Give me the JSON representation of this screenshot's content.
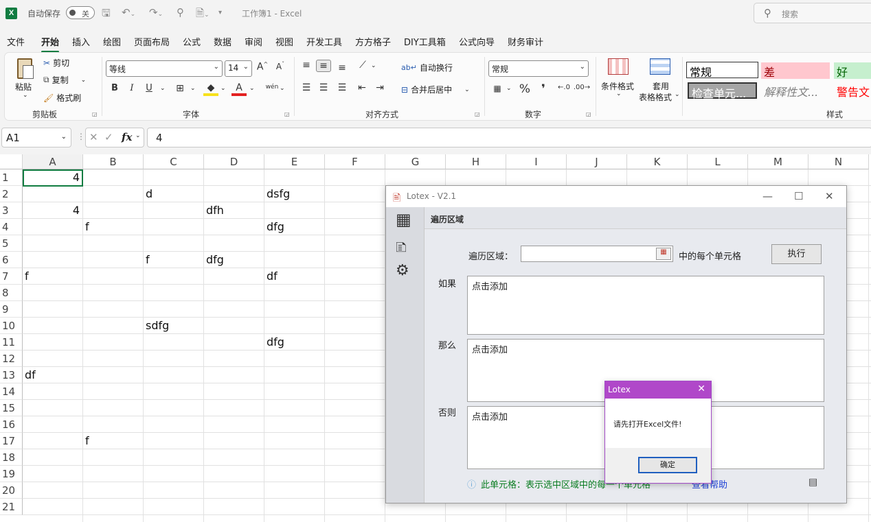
{
  "titlebar": {
    "logo": "X",
    "autosave_label": "自动保存",
    "autosave_state": "关",
    "doc_title": "工作簿1  -  Excel",
    "search_placeholder": "搜索",
    "icons": [
      "save-icon",
      "undo-icon",
      "redo-icon",
      "search-icon",
      "form-icon",
      "more-icon"
    ]
  },
  "menu": [
    "文件",
    "开始",
    "插入",
    "绘图",
    "页面布局",
    "公式",
    "数据",
    "审阅",
    "视图",
    "开发工具",
    "方方格子",
    "DIY工具箱",
    "公式向导",
    "财务审计"
  ],
  "active_menu": "开始",
  "ribbon": {
    "clipboard": {
      "paste": "粘贴",
      "cut": "剪切",
      "copy": "复制",
      "format_painter": "格式刷",
      "group": "剪贴板"
    },
    "font": {
      "family": "等线",
      "size": "14",
      "bold": "B",
      "italic": "I",
      "underline": "U",
      "phonetic": "wén",
      "group": "字体"
    },
    "alignment": {
      "wrap": "自动换行",
      "merge": "合并后居中",
      "group": "对齐方式"
    },
    "number": {
      "format": "常规",
      "percent": "%",
      "comma": "❜",
      "group": "数字"
    },
    "styles": {
      "conditional": "条件格式",
      "table": [
        "套用",
        "表格格式"
      ],
      "cells": [
        {
          "label": "常规",
          "bg": "#ffffff",
          "color": "#000000"
        },
        {
          "label": "差",
          "bg": "#ffc7ce",
          "color": "#9c0006"
        },
        {
          "label": "好",
          "bg": "#c6efce",
          "color": "#006100"
        },
        {
          "label": "检查单元...",
          "bg": "#a5a5a5",
          "color": "#ffffff"
        },
        {
          "label": "解释性文...",
          "bg": "#ffffff",
          "color": "#7f7f7f"
        },
        {
          "label": "警告文",
          "bg": "#ffffff",
          "color": "#ff0000"
        }
      ],
      "group": "样式"
    }
  },
  "formula_bar": {
    "name_box": "A1",
    "fx": "fx",
    "value": "4"
  },
  "grid": {
    "columns": [
      "A",
      "B",
      "C",
      "D",
      "E",
      "F",
      "G",
      "H",
      "I",
      "J",
      "K",
      "L",
      "M",
      "N"
    ],
    "rows": [
      "1",
      "2",
      "3",
      "4",
      "5",
      "6",
      "7",
      "8",
      "9",
      "10",
      "11",
      "12",
      "13",
      "14",
      "15",
      "16",
      "17",
      "18",
      "19",
      "20",
      "21"
    ],
    "cells": [
      {
        "ref": "A1",
        "value": "4"
      },
      {
        "ref": "C2",
        "value": "d"
      },
      {
        "ref": "E2",
        "value": "dsfg"
      },
      {
        "ref": "A3",
        "value": "4"
      },
      {
        "ref": "D3",
        "value": "dfh"
      },
      {
        "ref": "B4",
        "value": "f"
      },
      {
        "ref": "E4",
        "value": "dfg"
      },
      {
        "ref": "C6",
        "value": "f"
      },
      {
        "ref": "D6",
        "value": "dfg"
      },
      {
        "ref": "A7",
        "value": "f"
      },
      {
        "ref": "E7",
        "value": "df"
      },
      {
        "ref": "C10",
        "value": "sdfg"
      },
      {
        "ref": "E11",
        "value": "dfg"
      },
      {
        "ref": "A13",
        "value": "df"
      },
      {
        "ref": "B17",
        "value": "f"
      }
    ]
  },
  "lotex": {
    "title": "Lotex - V2.1",
    "tab": "遍历区域",
    "range_label": "遍历区域：",
    "range_value": "",
    "range_suffix": "中的每个单元格",
    "execute": "执行",
    "if_label": "如果",
    "then_label": "那么",
    "else_label": "否则",
    "placeholder": "点击添加",
    "hint": "此单元格：表示选中区域中的每一个单元格",
    "help": "查看帮助"
  },
  "dialog": {
    "title": "Lotex",
    "message": "请先打开Excel文件!",
    "ok": "确定"
  }
}
